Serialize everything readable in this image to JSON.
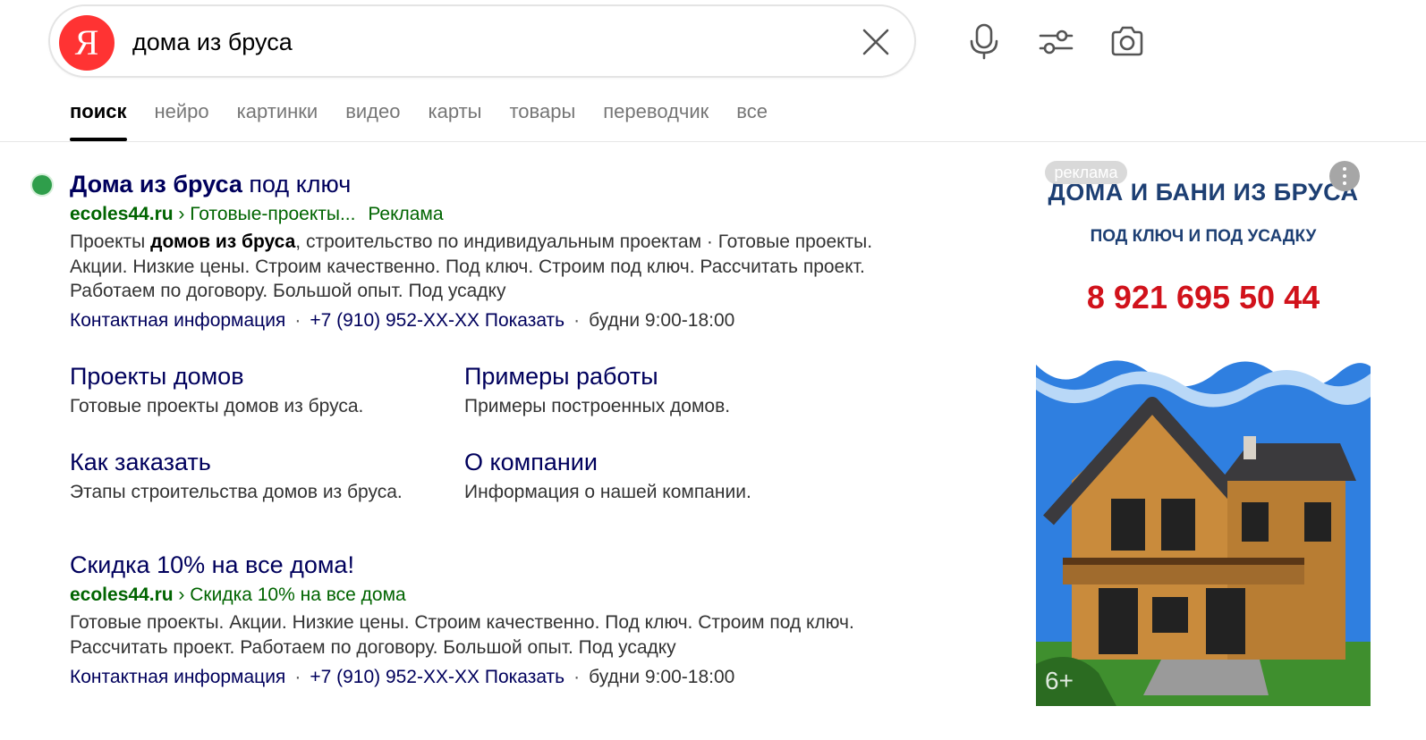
{
  "search": {
    "logo_letter": "Я",
    "query": "дома из бруса"
  },
  "tabs": [
    {
      "label": "поиск",
      "active": true
    },
    {
      "label": "нейро"
    },
    {
      "label": "картинки"
    },
    {
      "label": "видео"
    },
    {
      "label": "карты"
    },
    {
      "label": "товары"
    },
    {
      "label": "переводчик"
    },
    {
      "label": "все"
    }
  ],
  "icons": {
    "clear": "close-icon",
    "voice": "microphone-icon",
    "filters": "sliders-icon",
    "image_search": "camera-icon"
  },
  "result1": {
    "title_bold": "Дома из бруса",
    "title_rest": " под ключ",
    "domain": "ecoles44.ru",
    "path": "› Готовые-проекты...",
    "ad_label": "Реклама",
    "snippet_part1": "Проекты ",
    "snippet_bold": "домов из бруса",
    "snippet_part2": ", строительство по индивидуальным проектам · Готовые проекты. Акции. Низкие цены. Строим качественно. Под ключ. Строим под ключ. Рассчитать проект. Работаем по договору. Большой опыт. Под усадку",
    "contact_link": "Контактная информация",
    "phone": "+7 (910) 952-XX-XX",
    "show_phone": "Показать",
    "hours": "будни 9:00-18:00",
    "sitelinks": [
      {
        "title": "Проекты домов",
        "desc": "Готовые проекты домов из бруса."
      },
      {
        "title": "Примеры работы",
        "desc": "Примеры построенных домов."
      },
      {
        "title": "Как заказать",
        "desc": "Этапы строительства домов из бруса."
      },
      {
        "title": "О компании",
        "desc": "Информация о нашей компании."
      }
    ]
  },
  "result2": {
    "title": "Скидка 10% на все дома!",
    "domain": "ecoles44.ru",
    "path": "› Скидка 10% на все дома",
    "snippet": "Готовые проекты. Акции. Низкие цены. Строим качественно. Под ключ. Строим под ключ. Рассчитать проект. Работаем по договору. Большой опыт. Под усадку",
    "contact_link": "Контактная информация",
    "phone": "+7 (910) 952-XX-XX",
    "show_phone": "Показать",
    "hours": "будни 9:00-18:00"
  },
  "banner": {
    "badge": "реклама",
    "headline": "ДОМА И БАНИ ИЗ БРУСА",
    "subline": "ПОД КЛЮЧ И ПОД УСАДКУ",
    "phone": "8 921 695 50 44",
    "age_rating": "6+",
    "colors": {
      "headline": "#1d3f73",
      "phone": "#d1121b",
      "sky": "#2f7fe0"
    }
  }
}
